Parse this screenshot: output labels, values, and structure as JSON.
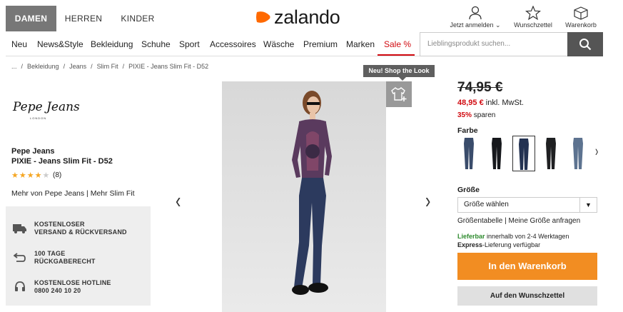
{
  "gender_tabs": [
    "DAMEN",
    "HERREN",
    "KINDER"
  ],
  "logo_text": "zalando",
  "user_nav": {
    "login": "Jetzt anmelden",
    "wishlist": "Wunschzettel",
    "cart": "Warenkorb"
  },
  "nav": [
    "Neu",
    "News&Style",
    "Bekleidung",
    "Schuhe",
    "Sport",
    "Accessoires",
    "Wäsche",
    "Premium",
    "Marken",
    "Sale %"
  ],
  "search": {
    "placeholder": "Lieblingsprodukt suchen..."
  },
  "breadcrumb": [
    "...",
    "Bekleidung",
    "Jeans",
    "Slim Fit",
    "PIXIE - Jeans Slim Fit - D52"
  ],
  "brand_logo": {
    "name": "Pepe Jeans",
    "sub": "LONDON"
  },
  "product": {
    "brand": "Pepe Jeans",
    "name": "PIXIE - Jeans Slim Fit - D52",
    "rating": 4,
    "rating_max": 5,
    "rating_count": "(8)",
    "more_links": "Mehr von Pepe Jeans | Mehr Slim Fit"
  },
  "benefits": [
    {
      "icon": "truck-icon",
      "line1": "KOSTENLOSER",
      "line2": "VERSAND & RÜCKVERSAND"
    },
    {
      "icon": "return-arrow-icon",
      "line1": "100 TAGE",
      "line2": "RÜCKGABERECHT"
    },
    {
      "icon": "headset-icon",
      "line1": "KOSTENLOSE HOTLINE",
      "line2": "0800 240 10 20"
    }
  ],
  "gallery": {
    "prev": "‹",
    "next": "›",
    "tooltip": "Neu! Shop the Look"
  },
  "price": {
    "old": "74,95 €",
    "new": "48,95 €",
    "new_suffix": "inkl. MwSt.",
    "saving_pct": "35%",
    "saving_text": "sparen"
  },
  "color_label": "Farbe",
  "swatch_colors": [
    "#3a4c6b",
    "#16181c",
    "#233252",
    "#1f2022",
    "#5d7390"
  ],
  "size": {
    "label": "Größe",
    "select_value": "Größe wählen",
    "links": "Größentabelle | Meine Größe anfragen"
  },
  "delivery": {
    "line1_strong": "Lieferbar",
    "line1_rest": "innerhalb von 2-4 Werktagen",
    "line2_strong": "Express",
    "line2_rest": "-Lieferung verfügbar"
  },
  "buttons": {
    "cart": "In den Warenkorb",
    "wishlist": "Auf den Wunschzettel"
  },
  "colors": {
    "accent_orange": "#f28d22",
    "sale_red": "#d10a10",
    "available_green": "#2e8b2e"
  }
}
